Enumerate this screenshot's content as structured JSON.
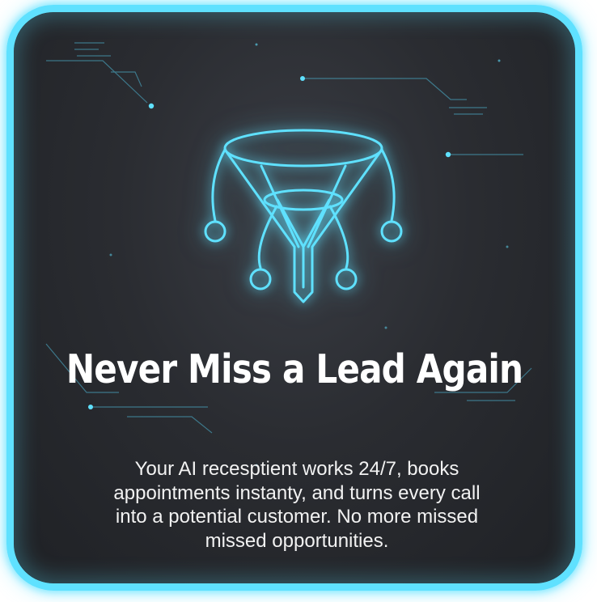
{
  "card": {
    "headline": "Never Miss a Lead Again",
    "body_lines": [
      "Your AI recesptient works 24/7, books",
      "appointments instanty, and turns every call",
      "into a  potential customer. No more missed",
      "missed opportunities."
    ]
  },
  "icon": {
    "name": "funnel-icon"
  },
  "colors": {
    "accent": "#5fe1ff",
    "background": "#2a2c31",
    "text": "#ffffff"
  }
}
